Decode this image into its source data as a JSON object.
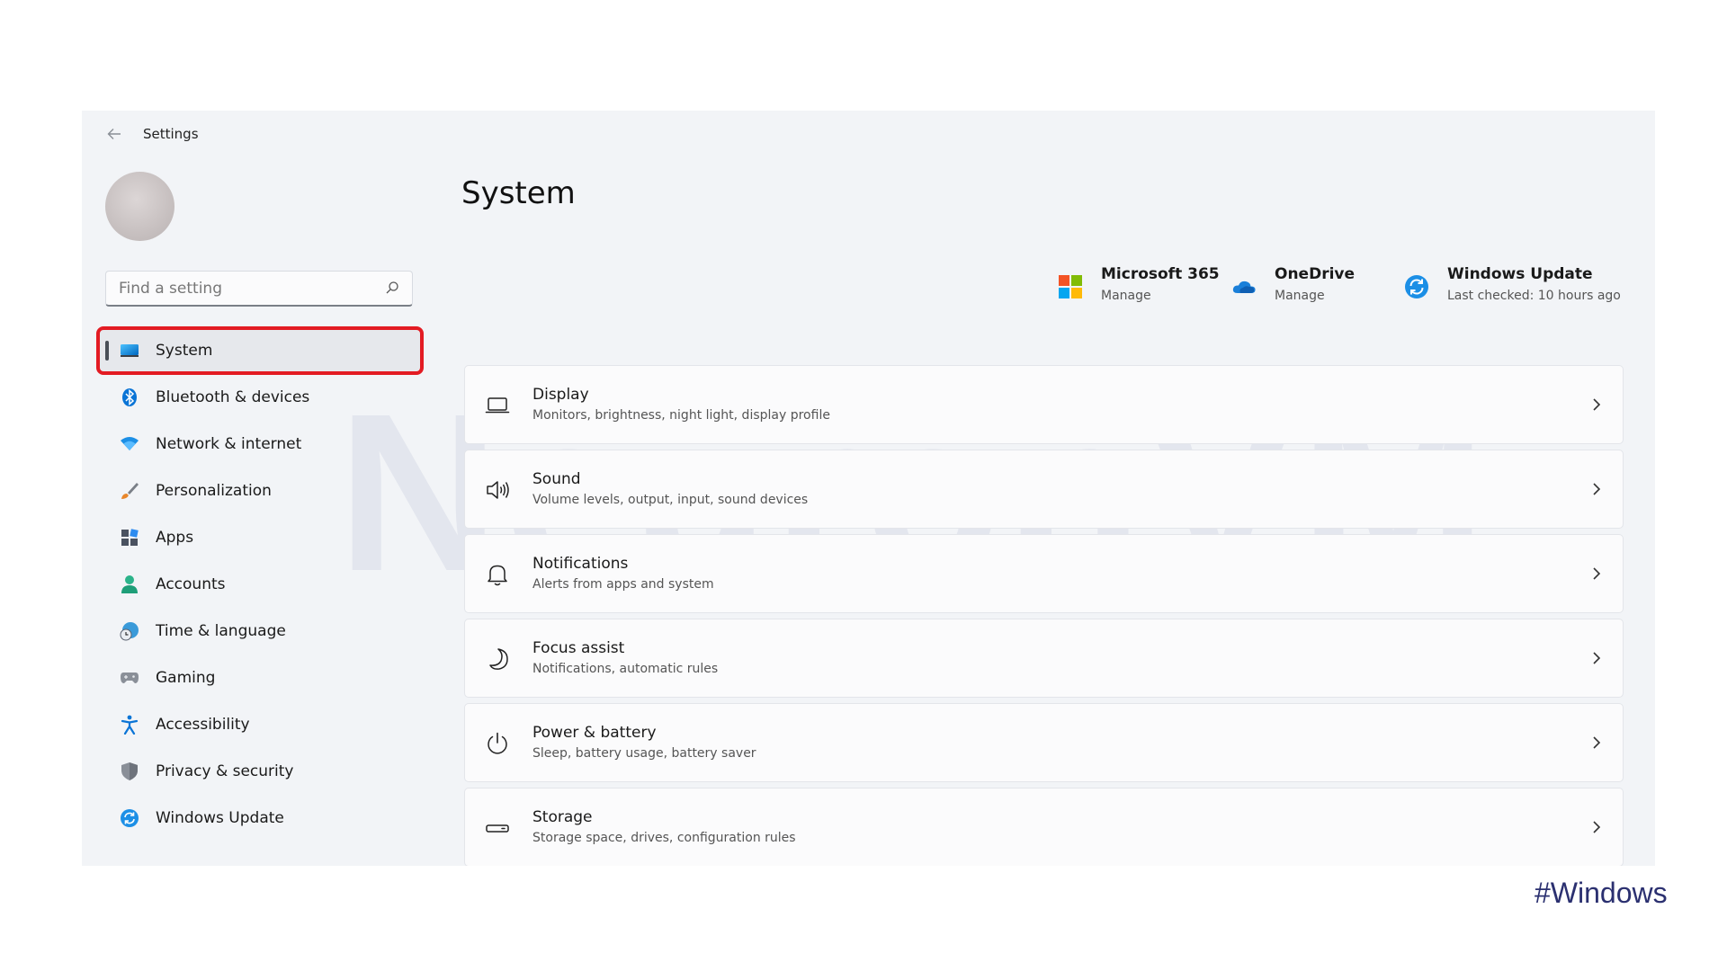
{
  "window": {
    "title": "Settings",
    "watermark": "NeuronVM",
    "search": {
      "placeholder": "Find a setting"
    }
  },
  "sidebar": {
    "items": [
      {
        "label": "System",
        "icon": "monitor-icon",
        "active": true
      },
      {
        "label": "Bluetooth & devices",
        "icon": "bluetooth-icon"
      },
      {
        "label": "Network & internet",
        "icon": "wifi-icon"
      },
      {
        "label": "Personalization",
        "icon": "brush-icon"
      },
      {
        "label": "Apps",
        "icon": "apps-icon"
      },
      {
        "label": "Accounts",
        "icon": "person-icon"
      },
      {
        "label": "Time & language",
        "icon": "globe-clock-icon"
      },
      {
        "label": "Gaming",
        "icon": "gamepad-icon"
      },
      {
        "label": "Accessibility",
        "icon": "accessibility-icon"
      },
      {
        "label": "Privacy & security",
        "icon": "shield-icon"
      },
      {
        "label": "Windows Update",
        "icon": "update-icon"
      }
    ]
  },
  "main": {
    "title": "System",
    "quick_links": [
      {
        "title": "Microsoft 365",
        "subtitle": "Manage",
        "icon": "microsoft-logo-icon"
      },
      {
        "title": "OneDrive",
        "subtitle": "Manage",
        "icon": "onedrive-cloud-icon"
      },
      {
        "title": "Windows Update",
        "subtitle": "Last checked: 10 hours ago",
        "icon": "update-icon"
      }
    ],
    "cards": [
      {
        "title": "Display",
        "subtitle": "Monitors, brightness, night light, display profile",
        "icon": "laptop-icon"
      },
      {
        "title": "Sound",
        "subtitle": "Volume levels, output, input, sound devices",
        "icon": "speaker-icon"
      },
      {
        "title": "Notifications",
        "subtitle": "Alerts from apps and system",
        "icon": "bell-icon"
      },
      {
        "title": "Focus assist",
        "subtitle": "Notifications, automatic rules",
        "icon": "moon-icon"
      },
      {
        "title": "Power & battery",
        "subtitle": "Sleep, battery usage, battery saver",
        "icon": "power-icon"
      },
      {
        "title": "Storage",
        "subtitle": "Storage space, drives, configuration rules",
        "icon": "drive-icon"
      }
    ]
  },
  "caption": "#Windows",
  "colors": {
    "highlight_box": "#e31b23",
    "accent": "#0067c0",
    "window_bg": "#f2f4f7",
    "card_bg": "#fbfbfc"
  }
}
